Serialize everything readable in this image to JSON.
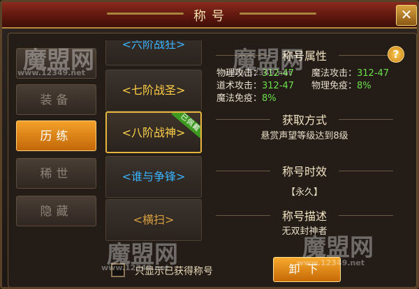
{
  "window": {
    "title": "称号",
    "close_label": "✕"
  },
  "categories": [
    {
      "label": "",
      "active": false
    },
    {
      "label": "装备",
      "active": false
    },
    {
      "label": "历练",
      "active": true
    },
    {
      "label": "稀世",
      "active": false
    },
    {
      "label": "隐藏",
      "active": false
    }
  ],
  "titles": [
    {
      "label": "<六阶战狂>",
      "color": "#39b4ff"
    },
    {
      "label": "<七阶战圣>",
      "color": "#ffce45"
    },
    {
      "label": "<八阶战神>",
      "color": "#ffd24a",
      "badge": "已佩戴"
    },
    {
      "label": "<谁与争锋>",
      "color": "#39b4ff"
    },
    {
      "label": "<横扫>",
      "color": "#d8a040"
    }
  ],
  "filter": {
    "label": "只显示已获得称号"
  },
  "attributes": {
    "header": "称号属性",
    "rows": [
      [
        {
          "label": "物理攻击：",
          "value": "312-47"
        },
        {
          "label": "魔法攻击：",
          "value": "312-47"
        }
      ],
      [
        {
          "label": "道术攻击：",
          "value": "312-47"
        },
        {
          "label": "物理免疫：",
          "value": "8%"
        }
      ],
      [
        {
          "label": "魔法免疫：",
          "value": "8%"
        }
      ]
    ]
  },
  "acquire": {
    "header": "获取方式",
    "text": "悬赏声望等级达到8级"
  },
  "duration": {
    "header": "称号时效",
    "text": "【永久】"
  },
  "description": {
    "header": "称号描述",
    "text": "无双封神者"
  },
  "actions": {
    "unequip_label": "卸下",
    "help_label": "?"
  },
  "watermarks": {
    "brand": "魔盟网",
    "url": "www.12349.net"
  },
  "colors": {
    "accent": "#f3a12a",
    "value_green": "#6ce04a",
    "title_red": "#8a2a1c"
  }
}
